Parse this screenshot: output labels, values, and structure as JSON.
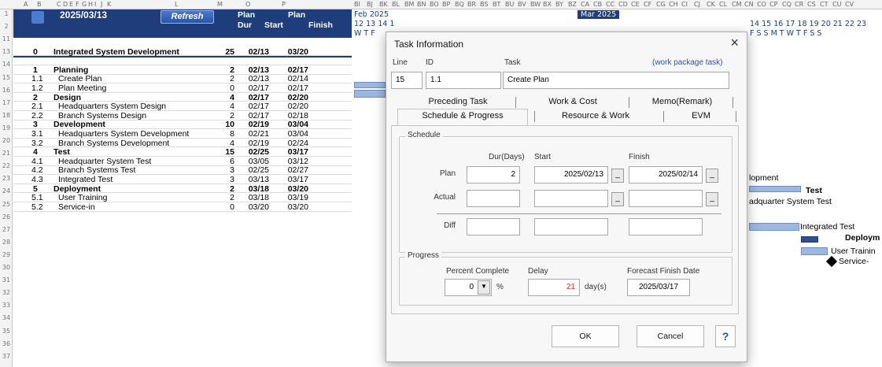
{
  "column_headers": [
    "A",
    "B",
    "C",
    "D",
    "E",
    "F",
    "G",
    "H",
    "I",
    "J",
    "K",
    "L",
    "M",
    "O",
    "P",
    "BI",
    "BJ",
    "BK",
    "BL",
    "BM",
    "BN",
    "BO",
    "BP",
    "BQ",
    "BR",
    "BS",
    "BT",
    "BU",
    "BV",
    "BW",
    "BX",
    "BY",
    "BZ",
    "CA",
    "CB",
    "CC",
    "CD",
    "CE",
    "CF",
    "CG",
    "CH",
    "CI",
    "CJ",
    "CK",
    "CL",
    "CM",
    "CN",
    "CO",
    "CP",
    "CQ",
    "CR",
    "CS",
    "CT",
    "CU",
    "CV"
  ],
  "row_numbers": [
    "1",
    "2",
    "11",
    "13",
    "14",
    "15",
    "16",
    "17",
    "18",
    "19",
    "20",
    "21",
    "22",
    "23",
    "24",
    "25",
    "26",
    "27",
    "28",
    "29",
    "30",
    "31",
    "32",
    "33",
    "34",
    "35",
    "36",
    "37"
  ],
  "header": {
    "date": "2025/03/13",
    "refresh_label": "Refresh",
    "plan_dur_top": "Plan",
    "plan_dur_bottom": "Dur",
    "plan_label": "Plan",
    "start_label": "Start",
    "finish_label": "Finish"
  },
  "gantt_header": {
    "month1": "Feb 2025",
    "month2": "Mar 2025",
    "days_left": "12 13 14 1",
    "days_right": "14 15 16 17 18 19 20 21 22 23",
    "weekdays_left": "W  T  F",
    "weekdays_right": "F  S  S  M  T  W  T  F  S  S"
  },
  "tasks": [
    {
      "no": "0",
      "name": "Integrated System Development",
      "dur": "25",
      "start": "02/13",
      "finish": "03/20",
      "level": 0
    },
    {
      "no": "",
      "name": "",
      "dur": "",
      "start": "",
      "finish": "",
      "level": 9
    },
    {
      "no": "1",
      "name": "Planning",
      "dur": "2",
      "start": "02/13",
      "finish": "02/17",
      "level": 1
    },
    {
      "no": "1.1",
      "name": "Create Plan",
      "dur": "2",
      "start": "02/13",
      "finish": "02/14",
      "level": 2
    },
    {
      "no": "1.2",
      "name": "Plan Meeting",
      "dur": "0",
      "start": "02/17",
      "finish": "02/17",
      "level": 2
    },
    {
      "no": "2",
      "name": "Design",
      "dur": "4",
      "start": "02/17",
      "finish": "02/20",
      "level": 1
    },
    {
      "no": "2.1",
      "name": "Headquarters System Design",
      "dur": "4",
      "start": "02/17",
      "finish": "02/20",
      "level": 2
    },
    {
      "no": "2.2",
      "name": "Branch Systems Design",
      "dur": "2",
      "start": "02/17",
      "finish": "02/18",
      "level": 2
    },
    {
      "no": "3",
      "name": "Development",
      "dur": "10",
      "start": "02/19",
      "finish": "03/04",
      "level": 1
    },
    {
      "no": "3.1",
      "name": "Headquarters System Development",
      "dur": "8",
      "start": "02/21",
      "finish": "03/04",
      "level": 2
    },
    {
      "no": "3.2",
      "name": "Branch Systems Development",
      "dur": "4",
      "start": "02/19",
      "finish": "02/24",
      "level": 2
    },
    {
      "no": "4",
      "name": "Test",
      "dur": "15",
      "start": "02/25",
      "finish": "03/17",
      "level": 1
    },
    {
      "no": "4.1",
      "name": "Headquarter System Test",
      "dur": "6",
      "start": "03/05",
      "finish": "03/12",
      "level": 2
    },
    {
      "no": "4.2",
      "name": "Branch Systems Test",
      "dur": "3",
      "start": "02/25",
      "finish": "02/27",
      "level": 2
    },
    {
      "no": "4.3",
      "name": "Integrated Test",
      "dur": "3",
      "start": "03/13",
      "finish": "03/17",
      "level": 2
    },
    {
      "no": "5",
      "name": "Deployment",
      "dur": "2",
      "start": "03/18",
      "finish": "03/20",
      "level": 1
    },
    {
      "no": "5.1",
      "name": "User Training",
      "dur": "2",
      "start": "03/18",
      "finish": "03/19",
      "level": 2
    },
    {
      "no": "5.2",
      "name": "Service-in",
      "dur": "0",
      "start": "03/20",
      "finish": "03/20",
      "level": 2
    }
  ],
  "gantt_labels": {
    "development": "lopment",
    "test": "Test",
    "hq_test": "adquarter System Test",
    "integrated_test": "Integrated Test",
    "deployment": "Deploym",
    "user_training": "User Trainin",
    "service_in": "Service-"
  },
  "dialog": {
    "title": "Task Information",
    "line_label": "Line",
    "id_label": "ID",
    "task_label": "Task",
    "wp_note": "(work package task)",
    "line_value": "15",
    "id_value": "1.1",
    "task_value": "Create Plan",
    "tabs_row1": [
      "Preceding Task",
      "Work & Cost",
      "Memo(Remark)"
    ],
    "tabs_row2": [
      "Schedule & Progress",
      "Resource & Work",
      "EVM"
    ],
    "schedule_title": "Schedule",
    "dur_label": "Dur(Days)",
    "start_label": "Start",
    "finish_label": "Finish",
    "plan_label": "Plan",
    "actual_label": "Actual",
    "diff_label": "Diff",
    "plan_dur": "2",
    "plan_start": "2025/02/13",
    "plan_finish": "2025/02/14",
    "progress_title": "Progress",
    "percent_label": "Percent Complete",
    "delay_label": "Delay",
    "forecast_label": "Forecast Finish Date",
    "percent_value": "0",
    "percent_unit": "%",
    "delay_value": "21",
    "delay_unit": "day(s)",
    "forecast_value": "2025/03/17",
    "ok_label": "OK",
    "cancel_label": "Cancel",
    "help_label": "?",
    "close_glyph": "×",
    "dropdown_glyph": "▼",
    "date_btn_glyph": "_"
  }
}
